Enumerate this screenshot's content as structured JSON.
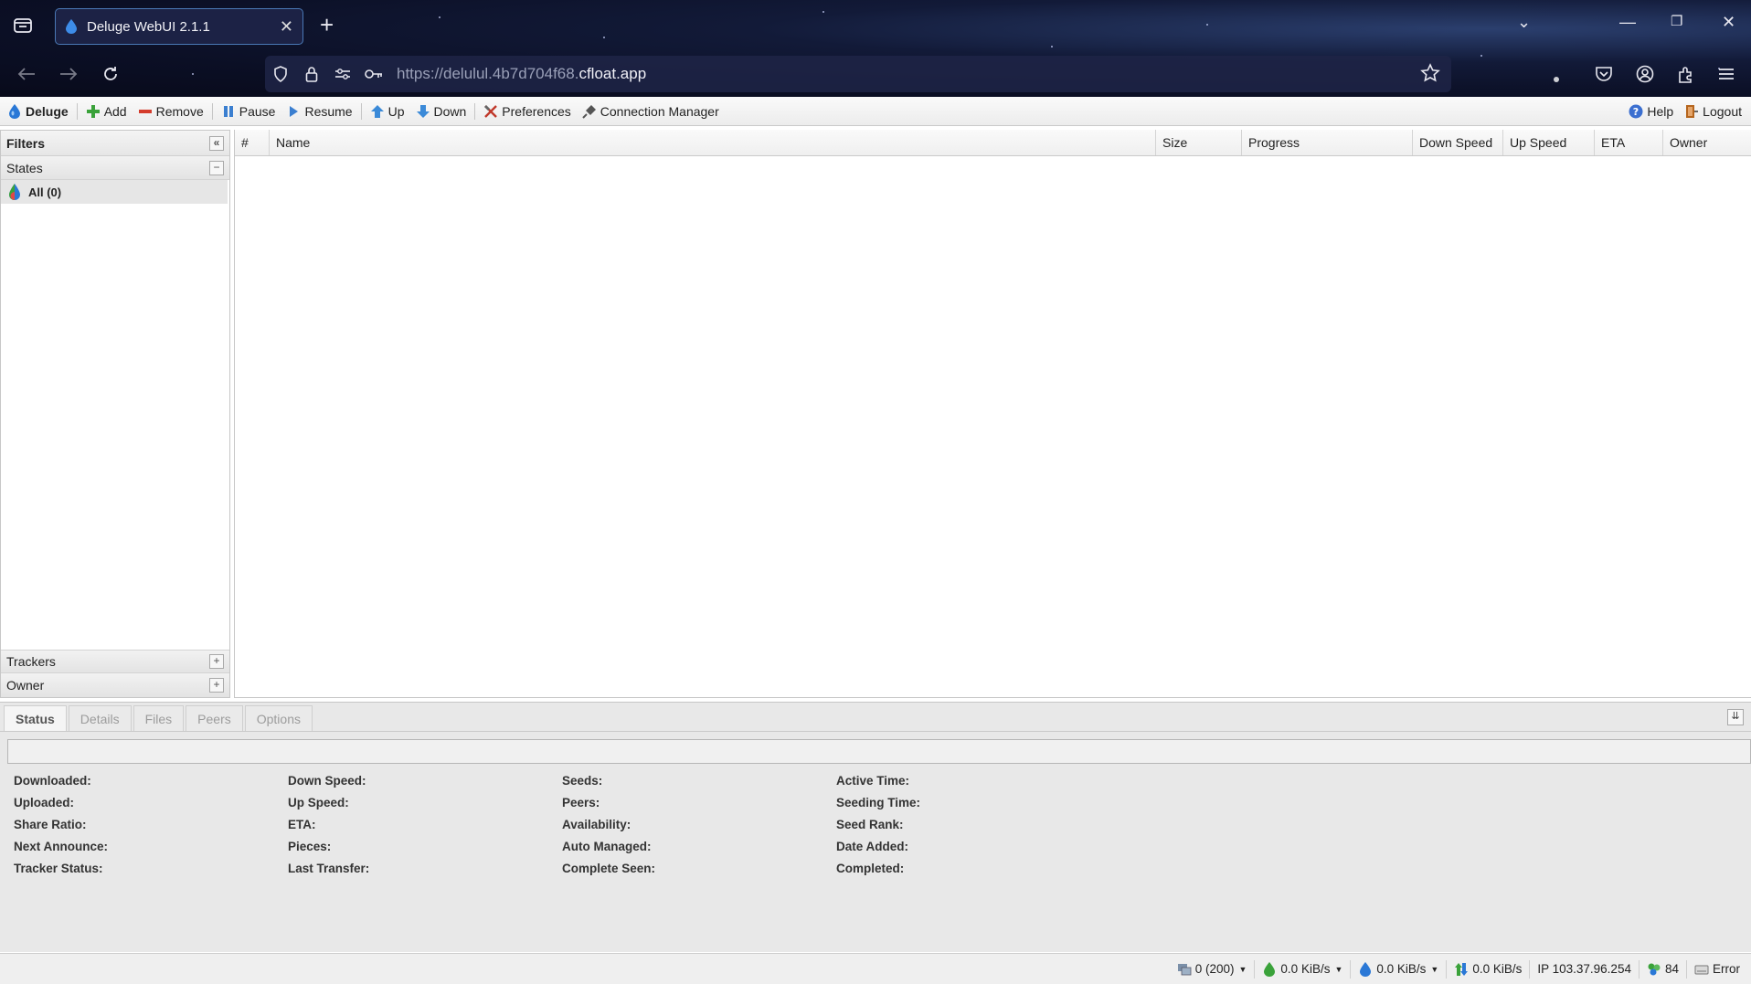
{
  "browser": {
    "tab_title": "Deluge WebUI 2.1.1",
    "url_prefix": "https://delulul.4b7d704f68.",
    "url_domain": "cfloat.app"
  },
  "toolbar": {
    "brand": "Deluge",
    "add": "Add",
    "remove": "Remove",
    "pause": "Pause",
    "resume": "Resume",
    "up": "Up",
    "down": "Down",
    "preferences": "Preferences",
    "connection_manager": "Connection Manager",
    "help": "Help",
    "logout": "Logout"
  },
  "filters": {
    "title": "Filters",
    "states_label": "States",
    "all_item": "All (0)",
    "trackers_label": "Trackers",
    "owner_label": "Owner"
  },
  "grid": {
    "columns": [
      "#",
      "Name",
      "Size",
      "Progress",
      "Down Speed",
      "Up Speed",
      "ETA",
      "Owner"
    ]
  },
  "details": {
    "tabs": [
      "Status",
      "Details",
      "Files",
      "Peers",
      "Options"
    ],
    "active_tab": "Status",
    "fields": [
      [
        "Downloaded:",
        "Down Speed:",
        "Seeds:",
        "Active Time:"
      ],
      [
        "Uploaded:",
        "Up Speed:",
        "Peers:",
        "Seeding Time:"
      ],
      [
        "Share Ratio:",
        "ETA:",
        "Availability:",
        "Seed Rank:"
      ],
      [
        "Next Announce:",
        "Pieces:",
        "Auto Managed:",
        "Date Added:"
      ],
      [
        "Tracker Status:",
        "Last Transfer:",
        "Complete Seen:",
        "Completed:"
      ]
    ]
  },
  "statusbar": {
    "connections": "0 (200)",
    "down_speed": "0.0 KiB/s",
    "up_speed": "0.0 KiB/s",
    "protocol": "0.0 KiB/s",
    "ip": "IP 103.37.96.254",
    "dht": "84",
    "error": "Error"
  },
  "colors": {
    "deluge_blue": "#2a78d6",
    "add_green": "#3aa23a",
    "remove_red": "#d43c2c"
  }
}
